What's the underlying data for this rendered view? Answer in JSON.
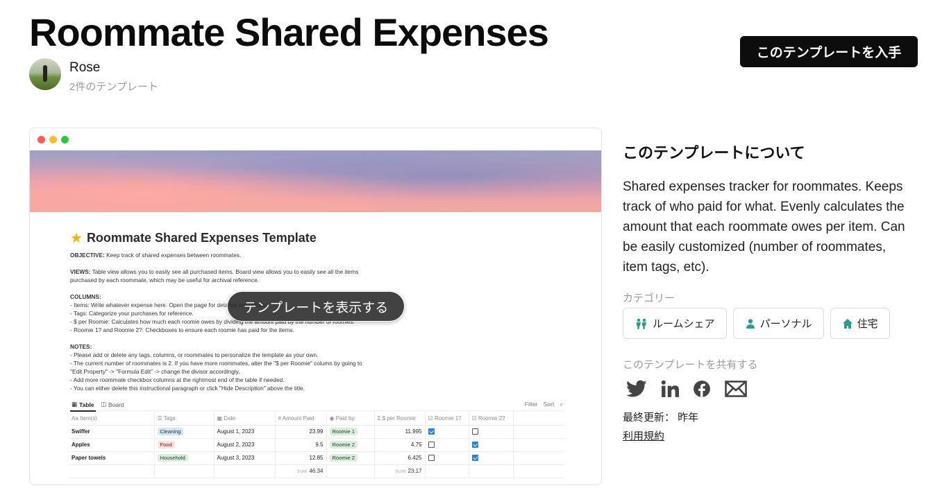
{
  "header": {
    "title": "Roommate Shared Expenses",
    "author_name": "Rose",
    "author_templates": "2件のテンプレート",
    "get_button": "このテンプレートを入手"
  },
  "preview": {
    "doc_title": "Roommate Shared Expenses Template",
    "lines": {
      "objective_label": "OBJECTIVE:",
      "objective": " Keep track of shared expenses between roommates.",
      "views_label": "VIEWS:",
      "views": " Table view allows you to easily see all purchased items. Board view allows you to easily see all the items\npurchased by each roommate, which may be useful for archival reference.",
      "columns_label": "COLUMNS:",
      "columns": "- Items: Write whatever expense here. Open the page for detailed breakdown.\n- Tags: Categorize your purchases for reference.\n- $ per Roomie: Calculates how much each roomie owes by dividing the amount paid by the number of roomies.\n- Roomie 1? and Roomie 2?: Checkboxes to ensure each roomie has paid for the items.",
      "notes_label": "NOTES:",
      "notes": "- Please add or delete any tags, columns, or roommates to personalize the template as your own.\n- The current number of roommates is 2. If you have more roommates, alter the \"$ per Roomie\" column by going to\n\"Edit Property\" -> \"Formula Edit\" -> change the divisor accordingly.\n- Add more roommate checkbox columns at the rightmost end of the table if needed.\n- You can either delete this instructional paragraph or click \"Hide Description\" above the title."
    },
    "views": {
      "table": "Table",
      "board": "Board",
      "filter": "Filter",
      "sort": "Sort"
    },
    "columns": [
      "Item(s)",
      "Tags",
      "Date",
      "Amount Paid",
      "Paid by:",
      "$ per Roomie",
      "Roomie 1?",
      "Roomie 2?"
    ],
    "column_prefixes": [
      "Aa",
      "☰",
      "▦",
      "#",
      "◉",
      "Σ",
      "☑",
      "☑"
    ],
    "rows": [
      {
        "item": "Swiffer",
        "tag": "Cleaning",
        "date": "August 1, 2023",
        "amount": "23.99",
        "paid_by": "Roomie 1",
        "per": "11.995",
        "r1": true,
        "r2": false
      },
      {
        "item": "Apples",
        "tag": "Food",
        "date": "August 2, 2023",
        "amount": "9.5",
        "paid_by": "Roomie 2",
        "per": "4.75",
        "r1": false,
        "r2": true
      },
      {
        "item": "Paper towels",
        "tag": "Household",
        "date": "August 3, 2023",
        "amount": "12.85",
        "paid_by": "Roomie 2",
        "per": "6.425",
        "r1": false,
        "r2": true
      }
    ],
    "sum_label": "SUM",
    "sum_amount": "46.34",
    "sum_per": "23.17",
    "overlay_button": "テンプレートを表示する"
  },
  "about": {
    "heading": "このテンプレートについて",
    "description": "Shared expenses tracker for roommates. Keeps track of who paid for what. Evenly calculates the amount that each roommate owes per item. Can be easily customized (number of roommates, item tags, etc).",
    "category_label": "カテゴリー",
    "categories": [
      {
        "label": "ルームシェア",
        "icon": "people-icon"
      },
      {
        "label": "パーソナル",
        "icon": "person-icon"
      },
      {
        "label": "住宅",
        "icon": "house-icon"
      }
    ],
    "share_label": "このテンプレートを共有する",
    "share_icons": [
      "twitter-icon",
      "linkedin-icon",
      "facebook-icon",
      "email-icon"
    ],
    "updated": "最終更新： 昨年",
    "terms": "利用規約",
    "accent_color": "#2a9d8f"
  }
}
